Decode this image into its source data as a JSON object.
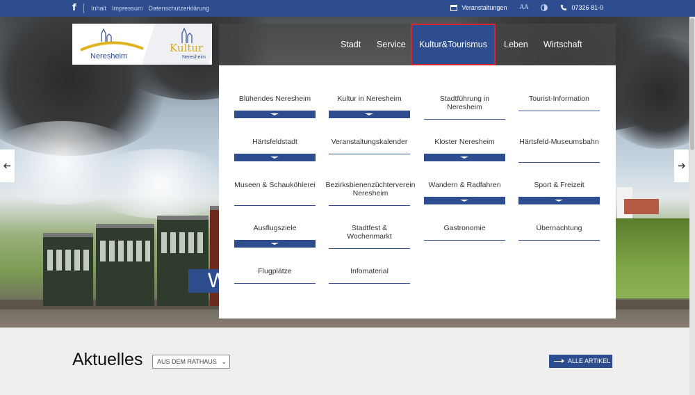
{
  "topbar": {
    "facebook": "f",
    "links": [
      "Inhalt",
      "Impressum",
      "Datenschutzerklärung"
    ],
    "events_label": "Veranstaltungen",
    "font_size_label": "AA",
    "phone": "07326 81-0"
  },
  "logo": {
    "city": "Neresheim",
    "kultur": "Kultur",
    "kultur_sub": "Neresheim"
  },
  "nav": {
    "items": [
      "Stadt",
      "Service",
      "Kultur&Tourismus",
      "Leben",
      "Wirtschaft"
    ],
    "active": "Kultur&Tourismus"
  },
  "menu": {
    "columns": [
      [
        "Blühendes Neresheim",
        "Härtsfeldstadt",
        "Museen & Schauköhlerei",
        "Ausflugsziele",
        "Flugplätze"
      ],
      [
        "Kultur in Neresheim",
        "Veranstaltungskalender",
        "Bezirksbienenzüchterverein Neresheim",
        "Stadtfest & Wochenmarkt",
        "Infomaterial"
      ],
      [
        "Stadtführung in Neresheim",
        "Kloster Neresheim",
        "Wandern & Radfahren",
        "Gastronomie"
      ],
      [
        "Tourist-Information",
        "Härtsfeld-Museumsbahn",
        "Sport & Freizeit",
        "Übernachtung"
      ]
    ]
  },
  "hero": {
    "partial_heading": "W"
  },
  "news": {
    "heading": "Aktuelles",
    "filter_value": "AUS DEM RATHAUS",
    "all_button": "ALLE ARTIKEL"
  },
  "colors": {
    "primary": "#2e4d8f",
    "highlight": "#d9232e"
  }
}
